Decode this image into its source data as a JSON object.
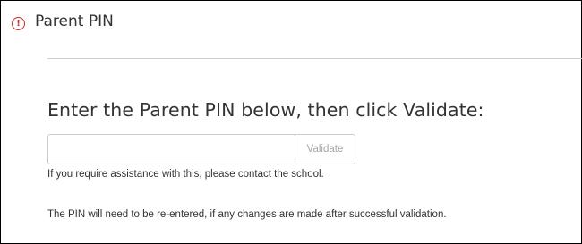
{
  "header": {
    "icon": "alert-circle-icon",
    "icon_glyph": "!",
    "icon_color": "#d9291c",
    "title": "Parent PIN"
  },
  "form": {
    "instruction": "Enter the Parent PIN below, then click Validate:",
    "pin_value": "",
    "pin_placeholder": "",
    "validate_label": "Validate",
    "help_text": "If you require assistance with this, please contact the school.",
    "note_text": "The PIN will need to be re-entered, if any changes are made after successful validation."
  }
}
